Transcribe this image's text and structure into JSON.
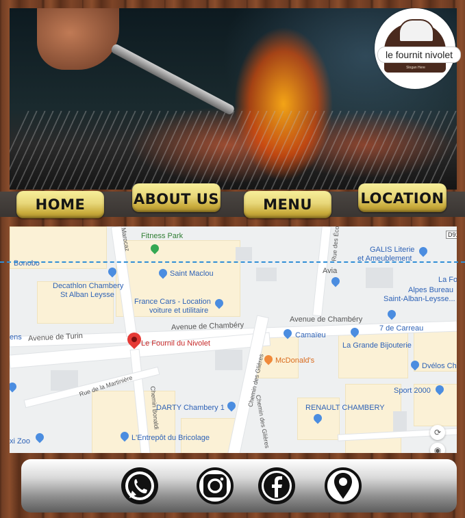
{
  "header": {
    "logo_text": "le fournit nivolet",
    "logo_slogan": "Slogan Here"
  },
  "nav": {
    "home": "HOME",
    "about": "ABOUT US",
    "menu": "MENU",
    "location": "LOCATION"
  },
  "map": {
    "route_badge": "D91",
    "roads": {
      "avenue_chambery_1": "Avenue de Chambéry",
      "avenue_chambery_2": "Avenue de Chambéry",
      "avenue_turin": "Avenue de Turin",
      "rue_martiniere": "Rue de la Martinière",
      "chemin_bonaldi": "Chemin Bonaldi",
      "chemin_glieres_1": "Chemin des Glières",
      "chemin_glieres_2": "Chemin des Glières",
      "rue_ecoles": "Rue des Éco",
      "marocaz": "Marocaz"
    },
    "places": {
      "fitness_park": "Fitness Park",
      "bonobo": "Bonobo",
      "saint_maclou": "Saint Maclou",
      "decathlon_1": "Decathlon Chambery",
      "decathlon_2": "St Alban Leysse",
      "france_cars_1": "France Cars - Location",
      "france_cars_2": "voiture et utilitaire",
      "avia": "Avia",
      "galis_1": "GALIS Literie",
      "galis_2": "et Ameublement",
      "la_fo": "La Fo",
      "alpes_bureau_1": "Alpes Bureau",
      "alpes_bureau_2": "Saint-Alban-Leysse...",
      "carreau": "7 de Carreau",
      "camaieu": "Camaïeu",
      "restaurant": "Le Fournil du Nivolet",
      "mcdonalds": "McDonald's",
      "bijouterie": "La Grande Bijouterie",
      "dvelos": "Dvélos Ch",
      "sport2000": "Sport 2000",
      "darty": "DARTY Chambery 1",
      "renault": "RENAULT CHAMBERY",
      "entrepot": "L'Entrepôt du Bricolage",
      "ens": "ens",
      "xi_zoo": "xi Zoo"
    }
  },
  "footer": {
    "icons": [
      "whatsapp-icon",
      "instagram-icon",
      "facebook-icon",
      "location-pin-icon"
    ]
  },
  "colors": {
    "nav_gold": "#e8d77a",
    "nav_bar": "#3f3a37",
    "map_blue_poi": "#2e62b6",
    "map_pin_red": "#e53935",
    "dashed_line": "#2f8ed6"
  }
}
